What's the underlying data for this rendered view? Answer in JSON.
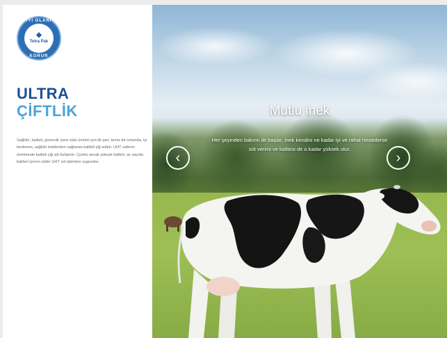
{
  "logo": {
    "ring_top": "İYİ OLANI",
    "ring_bottom": "KORUR",
    "brand": "Tetra Pak"
  },
  "left_panel": {
    "title_line1": "ULTRA",
    "title_line2": "ÇİFTLİK",
    "description": "Sağlıklı, kaliteli, güvenilir içme sütü üretimi için ilk şart, temiz bir ortamda, iyi beslenen, sağlıklı ineklerden sağlanan kaliteli çiğ süttür. UHT sütlerin üretiminde kaliteli çiğ süt kullanılır. Çünkü ancak yüksek kaliteli, az sayıda bakteri içeren sütler UHT ısıl işlemine uygundur."
  },
  "slider": {
    "title": "Mutlu inek",
    "text": "Her şeyinden bakımı ile başlar. İnek kendini ne kadar iyi ve rahat hissederse süt verimi ve kalitesi de o kadar yüksek olur.",
    "prev_icon": "‹",
    "next_icon": "›"
  },
  "colors": {
    "title_dark_blue": "#1d4f94",
    "title_light_blue": "#4aa3d9",
    "logo_blue": "#2d6fb5"
  }
}
